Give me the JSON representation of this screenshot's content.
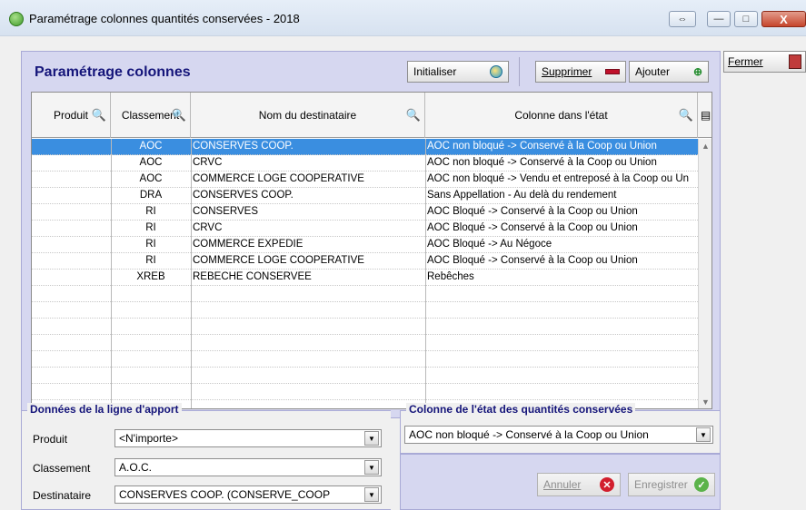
{
  "window": {
    "title": "Paramétrage colonnes quantités conservées - 2018",
    "restore_label": "⇔",
    "minimize_label": "—",
    "maximize_label": "□",
    "close_label": "X"
  },
  "panel": {
    "title": "Paramétrage colonnes",
    "initialiser_label": "Initialiser",
    "supprimer_label": "Supprimer",
    "ajouter_label": "Ajouter"
  },
  "side": {
    "fermer_label": "Fermer"
  },
  "table": {
    "columns": [
      "Produit",
      "Classement",
      "Nom du destinataire",
      "Colonne dans l'état"
    ],
    "rows": [
      {
        "produit": "",
        "classement": "AOC",
        "destinataire": "CONSERVES COOP.",
        "colonne": "AOC non bloqué -> Conservé à la Coop ou Union"
      },
      {
        "produit": "",
        "classement": "AOC",
        "destinataire": "CRVC",
        "colonne": "AOC non bloqué -> Conservé à la Coop ou Union"
      },
      {
        "produit": "",
        "classement": "AOC",
        "destinataire": "COMMERCE LOGE COOPERATIVE",
        "colonne": "AOC non bloqué -> Vendu et entreposé à la Coop ou Un"
      },
      {
        "produit": "",
        "classement": "DRA",
        "destinataire": "CONSERVES COOP.",
        "colonne": "Sans Appellation - Au delà du rendement"
      },
      {
        "produit": "",
        "classement": "RI",
        "destinataire": "CONSERVES",
        "colonne": "AOC Bloqué -> Conservé à la Coop ou Union"
      },
      {
        "produit": "",
        "classement": "RI",
        "destinataire": "CRVC",
        "colonne": "AOC Bloqué -> Conservé à la Coop ou Union"
      },
      {
        "produit": "",
        "classement": "RI",
        "destinataire": "COMMERCE EXPEDIE",
        "colonne": "AOC Bloqué -> Au Négoce"
      },
      {
        "produit": "",
        "classement": "RI",
        "destinataire": "COMMERCE LOGE COOPERATIVE",
        "colonne": "AOC Bloqué -> Conservé à la Coop ou Union"
      },
      {
        "produit": "",
        "classement": "XREB",
        "destinataire": "REBECHE CONSERVEE",
        "colonne": "Rebêches"
      }
    ]
  },
  "apport": {
    "title": "Données de la ligne d'apport",
    "produit_label": "Produit",
    "produit_value": "<N'importe>",
    "classement_label": "Classement",
    "classement_value": "A.O.C.",
    "destinataire_label": "Destinataire",
    "destinataire_value": "CONSERVES COOP. (CONSERVE_COOP"
  },
  "etat": {
    "title": "Colonne de l'état des quantités conservées",
    "value": "AOC non bloqué -> Conservé à la Coop ou Union"
  },
  "actions": {
    "annuler_label": "Annuler",
    "enregistrer_label": "Enregistrer"
  }
}
